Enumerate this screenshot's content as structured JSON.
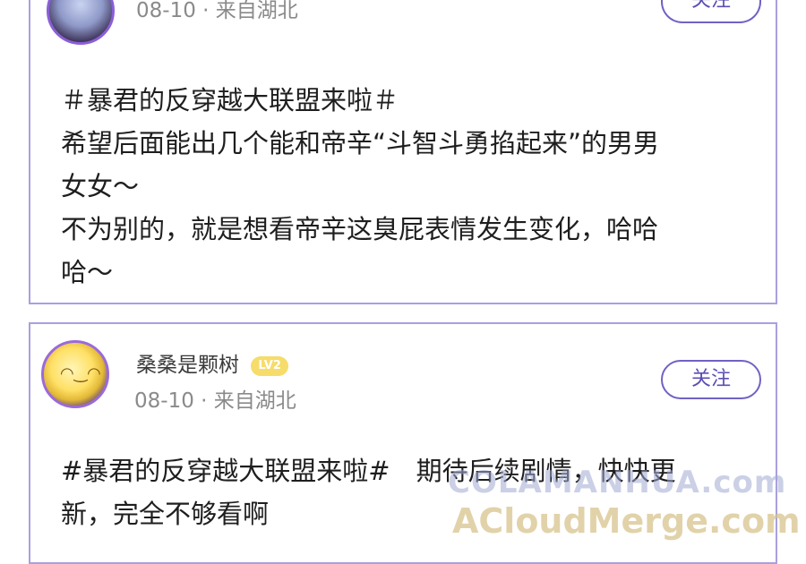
{
  "posts": [
    {
      "username": "",
      "level_badge": "",
      "date": "08-10",
      "separator": "·",
      "location": "来自湖北",
      "follow_label": "关注",
      "content_lines": [
        "＃暴君的反穿越大联盟来啦＃",
        "希望后面能出几个能和帝辛“斗智斗勇掐起来”的男男",
        "女女～",
        "不为别的，就是想看帝辛这臭屁表情发生变化，哈哈",
        "哈～"
      ]
    },
    {
      "username": "桑桑是颗树",
      "level_badge": "LV2",
      "date": "08-10",
      "separator": "·",
      "location": "来自湖北",
      "follow_label": "关注",
      "content_lines": [
        "#暴君的反穿越大联盟来啦#　期待后续剧情，快快更",
        "新，完全不够看啊"
      ]
    }
  ],
  "watermarks": {
    "line1": "COLAMANHUA.com",
    "line2": "ACloudMerge.com"
  },
  "colors": {
    "card_border": "#a8a0e0",
    "follow_accent": "#6f62c4",
    "level_badge": "#f6dc6a",
    "meta_text": "#8a8a8a"
  }
}
